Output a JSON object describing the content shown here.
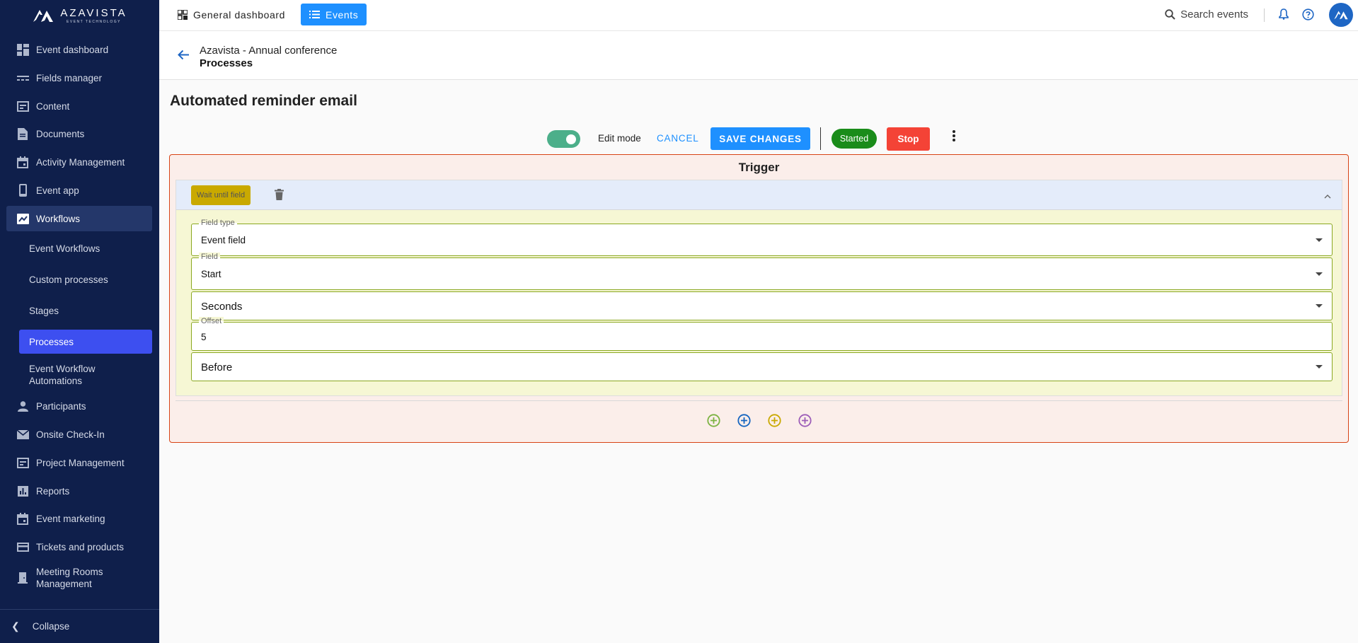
{
  "brand": {
    "name": "AZAVISTA",
    "tagline": "EVENT TECHNOLOGY"
  },
  "sidebar": {
    "items": [
      {
        "label": "Event dashboard",
        "icon": "dashboard-icon"
      },
      {
        "label": "Fields manager",
        "icon": "fields-icon"
      },
      {
        "label": "Content",
        "icon": "content-icon"
      },
      {
        "label": "Documents",
        "icon": "document-icon"
      },
      {
        "label": "Activity Management",
        "icon": "calendar-icon"
      },
      {
        "label": "Event app",
        "icon": "phone-icon"
      },
      {
        "label": "Workflows",
        "icon": "workflow-icon"
      }
    ],
    "sub_items": [
      {
        "label": "Event Workflows"
      },
      {
        "label": "Custom processes"
      },
      {
        "label": "Stages"
      },
      {
        "label": "Processes"
      },
      {
        "label": "Event Workflow Automations"
      }
    ],
    "items_after": [
      {
        "label": "Participants",
        "icon": "person-icon"
      },
      {
        "label": "Onsite Check-In",
        "icon": "mail-icon"
      },
      {
        "label": "Project Management",
        "icon": "project-icon"
      },
      {
        "label": "Reports",
        "icon": "reports-icon"
      },
      {
        "label": "Event marketing",
        "icon": "calendar-icon"
      },
      {
        "label": "Tickets and products",
        "icon": "card-icon"
      },
      {
        "label": "Meeting Rooms Management",
        "icon": "door-icon"
      }
    ],
    "collapse_label": "Collapse"
  },
  "topbar": {
    "tab_general": "General dashboard",
    "tab_events": "Events",
    "search_label": "Search events"
  },
  "header": {
    "event_name": "Azavista - Annual conference",
    "section": "Processes"
  },
  "page_title": "Automated reminder email",
  "toolbar": {
    "edit_mode_label": "Edit mode",
    "edit_mode_on": true,
    "cancel_label": "CANCEL",
    "save_label": "SAVE CHANGES",
    "status_badge": "Started",
    "stop_label": "Stop"
  },
  "trigger": {
    "title": "Trigger",
    "step_chip": "Wait until field",
    "fields": {
      "field_type": {
        "label": "Field type",
        "value": "Event field"
      },
      "field": {
        "label": "Field",
        "value": "Start"
      },
      "unit": {
        "value": "Seconds"
      },
      "offset": {
        "label": "Offset",
        "value": "5"
      },
      "direction": {
        "value": "Before"
      }
    },
    "add_buttons": [
      {
        "icon": "add-circle-green-icon",
        "color": "#7cb342"
      },
      {
        "icon": "add-circle-blue-icon",
        "color": "#1565c0"
      },
      {
        "icon": "add-circle-yellow-icon",
        "color": "#c9a900"
      },
      {
        "icon": "add-circle-purple-icon",
        "color": "#9c5db8"
      }
    ]
  },
  "colors": {
    "sidebar_bg": "#0f1f4b",
    "accent": "#1e90ff",
    "selected": "#3d4ff0",
    "started": "#1a8c1a",
    "stop": "#f44336"
  }
}
